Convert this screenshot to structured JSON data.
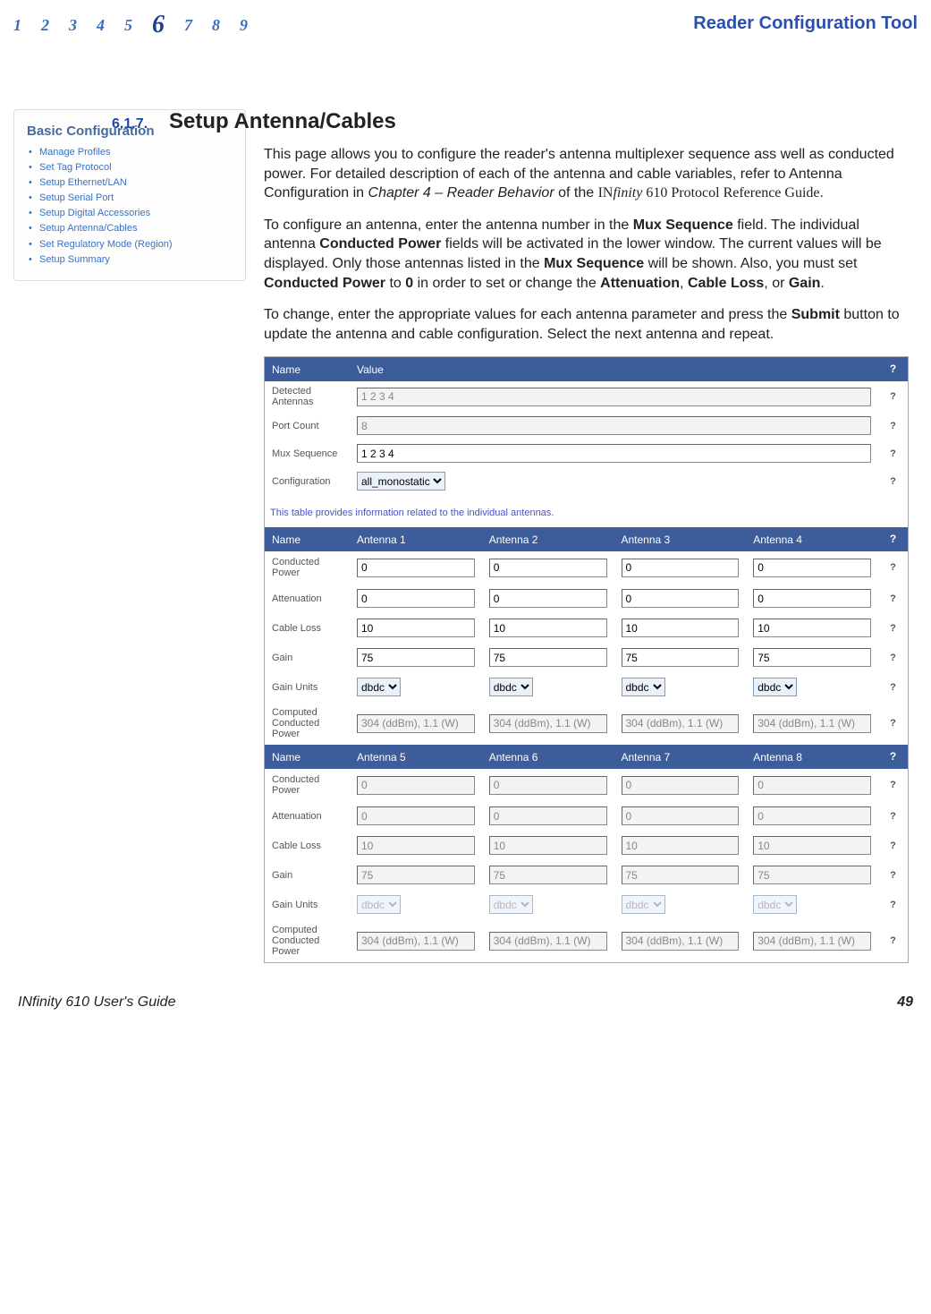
{
  "header": {
    "chapters": [
      "1",
      "2",
      "3",
      "4",
      "5",
      "6",
      "7",
      "8",
      "9"
    ],
    "current_chapter": "6",
    "app_title": "Reader Configuration Tool"
  },
  "sidebar": {
    "heading": "Basic Configuration",
    "items": [
      "Manage Profiles",
      "Set Tag Protocol",
      "Setup Ethernet/LAN",
      "Setup Serial Port",
      "Setup Digital Accessories",
      "Setup Antenna/Cables",
      "Set Regulatory Mode (Region)",
      "Setup Summary"
    ]
  },
  "section": {
    "number": "6.1.7.",
    "title": "Setup Antenna/Cables",
    "para1_a": "This page allows you to configure the reader's antenna multiplexer sequence ass well as conducted power. For detailed description of each of the antenna and cable variables, refer to Antenna Configuration in ",
    "para1_em": "Chapter 4 – Reader Behavior",
    "para1_b": " of the ",
    "para1_title": "INfinity 610 Protocol Reference Guide",
    "para1_c": ".",
    "para2_a": "To configure an antenna, enter the antenna number in the ",
    "b_mux1": "Mux Sequence",
    "para2_b": " field. The individual antenna ",
    "b_cp": "Conducted Power",
    "para2_c": " fields will be activated in the lower window. The current values will be displayed. Only those antennas listed in the ",
    "b_mux2": "Mux Sequence",
    "para2_d": " will be shown. Also, you must set ",
    "b_cp2": "Conducted Power",
    "para2_e": " to ",
    "b_zero": "0",
    "para2_f": " in order to set or change the ",
    "b_att": "Attenuation",
    "comma1": ", ",
    "b_cl": "Cable Loss",
    "comma2": ", or ",
    "b_gain": "Gain",
    "period": ".",
    "para3_a": "To change, enter the appropriate values for each antenna parameter and press the ",
    "b_submit": "Submit",
    "para3_b": " button to update the antenna and cable configuration. Select the next antenna and repeat."
  },
  "tool": {
    "head_name": "Name",
    "head_value": "Value",
    "help_mark": "?",
    "rows_top": [
      {
        "label": "Detected Antennas",
        "value": "1 2 3 4",
        "disabled": true
      },
      {
        "label": "Port Count",
        "value": "8",
        "disabled": true
      },
      {
        "label": "Mux Sequence",
        "value": "1 2 3 4",
        "disabled": false
      }
    ],
    "config_label": "Configuration",
    "config_value": "all_monostatic",
    "note": "This table provides information related to the individual antennas.",
    "ant_row_labels": [
      "Conducted Power",
      "Attenuation",
      "Cable Loss",
      "Gain",
      "Gain Units",
      "Computed Conducted Power"
    ],
    "group1": {
      "heads": [
        "Name",
        "Antenna 1",
        "Antenna 2",
        "Antenna 3",
        "Antenna 4"
      ],
      "enabled": true,
      "rows": {
        "conducted_power": [
          "0",
          "0",
          "0",
          "0"
        ],
        "attenuation": [
          "0",
          "0",
          "0",
          "0"
        ],
        "cable_loss": [
          "10",
          "10",
          "10",
          "10"
        ],
        "gain": [
          "75",
          "75",
          "75",
          "75"
        ],
        "gain_units": [
          "dbdc",
          "dbdc",
          "dbdc",
          "dbdc"
        ],
        "computed": [
          "304 (ddBm), 1.1 (W)",
          "304 (ddBm), 1.1 (W)",
          "304 (ddBm), 1.1 (W)",
          "304 (ddBm), 1.1 (W)"
        ]
      }
    },
    "group2": {
      "heads": [
        "Name",
        "Antenna 5",
        "Antenna 6",
        "Antenna 7",
        "Antenna 8"
      ],
      "enabled": false,
      "rows": {
        "conducted_power": [
          "0",
          "0",
          "0",
          "0"
        ],
        "attenuation": [
          "0",
          "0",
          "0",
          "0"
        ],
        "cable_loss": [
          "10",
          "10",
          "10",
          "10"
        ],
        "gain": [
          "75",
          "75",
          "75",
          "75"
        ],
        "gain_units": [
          "dbdc",
          "dbdc",
          "dbdc",
          "dbdc"
        ],
        "computed": [
          "304 (ddBm), 1.1 (W)",
          "304 (ddBm), 1.1 (W)",
          "304 (ddBm), 1.1 (W)",
          "304 (ddBm), 1.1 (W)"
        ]
      }
    }
  },
  "footer": {
    "left_a": "IN",
    "left_em": "finity",
    "left_b": " 610 User's Guide",
    "page": "49"
  }
}
